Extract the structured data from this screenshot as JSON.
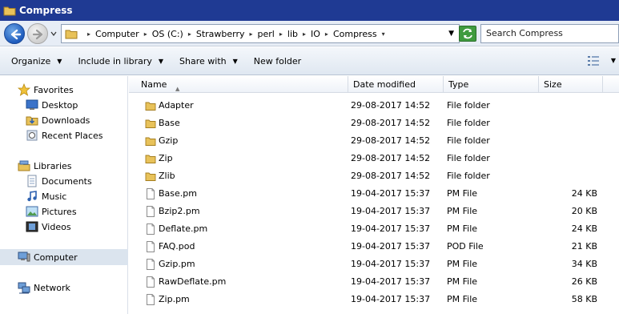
{
  "window": {
    "title": "Compress"
  },
  "address": {
    "breadcrumbs": [
      "Computer",
      "OS (C:)",
      "Strawberry",
      "perl",
      "lib",
      "IO",
      "Compress"
    ],
    "search_placeholder": "Search Compress"
  },
  "toolbar": {
    "items": [
      {
        "label": "Organize",
        "has_dropdown": true
      },
      {
        "label": "Include in library",
        "has_dropdown": true
      },
      {
        "label": "Share with",
        "has_dropdown": true
      },
      {
        "label": "New folder",
        "has_dropdown": false
      }
    ]
  },
  "nav": {
    "favorites": {
      "label": "Favorites",
      "items": [
        "Desktop",
        "Downloads",
        "Recent Places"
      ]
    },
    "libraries": {
      "label": "Libraries",
      "items": [
        "Documents",
        "Music",
        "Pictures",
        "Videos"
      ]
    },
    "computer": {
      "label": "Computer"
    },
    "network": {
      "label": "Network"
    }
  },
  "columns": [
    "Name",
    "Date modified",
    "Type",
    "Size"
  ],
  "files": [
    {
      "name": "Adapter",
      "date": "29-08-2017 14:52",
      "type": "File folder",
      "size": "",
      "icon": "folder-icon"
    },
    {
      "name": "Base",
      "date": "29-08-2017 14:52",
      "type": "File folder",
      "size": "",
      "icon": "folder-icon"
    },
    {
      "name": "Gzip",
      "date": "29-08-2017 14:52",
      "type": "File folder",
      "size": "",
      "icon": "folder-icon"
    },
    {
      "name": "Zip",
      "date": "29-08-2017 14:52",
      "type": "File folder",
      "size": "",
      "icon": "folder-icon"
    },
    {
      "name": "Zlib",
      "date": "29-08-2017 14:52",
      "type": "File folder",
      "size": "",
      "icon": "folder-icon"
    },
    {
      "name": "Base.pm",
      "date": "19-04-2017 15:37",
      "type": "PM File",
      "size": "24 KB",
      "icon": "file-icon"
    },
    {
      "name": "Bzip2.pm",
      "date": "19-04-2017 15:37",
      "type": "PM File",
      "size": "20 KB",
      "icon": "file-icon"
    },
    {
      "name": "Deflate.pm",
      "date": "19-04-2017 15:37",
      "type": "PM File",
      "size": "24 KB",
      "icon": "file-icon"
    },
    {
      "name": "FAQ.pod",
      "date": "19-04-2017 15:37",
      "type": "POD File",
      "size": "21 KB",
      "icon": "file-icon"
    },
    {
      "name": "Gzip.pm",
      "date": "19-04-2017 15:37",
      "type": "PM File",
      "size": "34 KB",
      "icon": "file-icon"
    },
    {
      "name": "RawDeflate.pm",
      "date": "19-04-2017 15:37",
      "type": "PM File",
      "size": "26 KB",
      "icon": "file-icon"
    },
    {
      "name": "Zip.pm",
      "date": "19-04-2017 15:37",
      "type": "PM File",
      "size": "58 KB",
      "icon": "file-icon"
    }
  ],
  "colors": {
    "titlebar": "#1f3a93",
    "selection": "#dbe4ee",
    "folder": "#e8c25a"
  }
}
